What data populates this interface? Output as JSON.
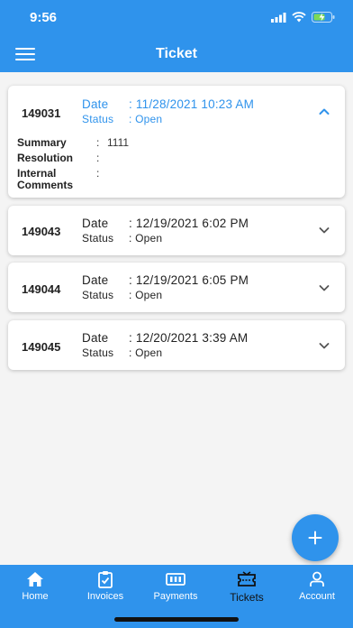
{
  "status_bar": {
    "time": "9:56"
  },
  "app_bar": {
    "title": "Ticket"
  },
  "labels": {
    "date": "Date",
    "status": "Status",
    "separator": ":",
    "summary": "Summary",
    "resolution": "Resolution",
    "internal_comments_line1": "Internal",
    "internal_comments_line2": "Comments"
  },
  "tickets": [
    {
      "id": "149031",
      "date": "11/28/2021 10:23 AM",
      "status": "Open",
      "expanded": true,
      "summary": "1111",
      "resolution": "",
      "internal_comments": ""
    },
    {
      "id": "149043",
      "date": "12/19/2021 6:02 PM",
      "status": "Open",
      "expanded": false
    },
    {
      "id": "149044",
      "date": "12/19/2021 6:05 PM",
      "status": "Open",
      "expanded": false
    },
    {
      "id": "149045",
      "date": "12/20/2021 3:39 AM",
      "status": "Open",
      "expanded": false
    }
  ],
  "fab": {
    "icon": "plus-icon",
    "symbol": "+"
  },
  "bottom_nav": {
    "items": [
      {
        "label": "Home",
        "icon": "home-icon"
      },
      {
        "label": "Invoices",
        "icon": "invoices-icon"
      },
      {
        "label": "Payments",
        "icon": "payments-icon"
      },
      {
        "label": "Tickets",
        "icon": "tickets-icon",
        "active": true
      },
      {
        "label": "Account",
        "icon": "account-icon"
      }
    ]
  },
  "colors": {
    "primary": "#2f93ec",
    "background": "#f4f4f4",
    "active_nav": "#111111"
  }
}
